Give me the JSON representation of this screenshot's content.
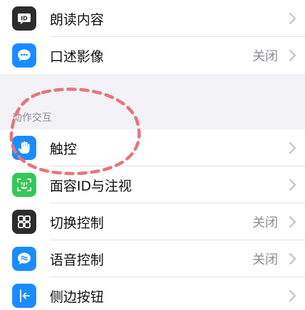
{
  "accessibility": {
    "top_rows": [
      {
        "label": "朗读内容",
        "value": "",
        "icon": "speech-bubble-icon",
        "color": "#2c2c2e"
      },
      {
        "label": "口述影像",
        "value": "关闭",
        "icon": "chat-bubble-icon",
        "color": "#1a8cff"
      }
    ],
    "section_header": "动作交互",
    "interaction_rows": [
      {
        "label": "触控",
        "value": "",
        "icon": "hand-touch-icon",
        "color": "#1a8cff"
      },
      {
        "label": "面容ID与注视",
        "value": "",
        "icon": "face-id-icon",
        "color": "#34c759"
      },
      {
        "label": "切换控制",
        "value": "关闭",
        "icon": "grid-icon",
        "color": "#2c2c2e"
      },
      {
        "label": "语音控制",
        "value": "关闭",
        "icon": "voice-bubble-icon",
        "color": "#1a8cff"
      },
      {
        "label": "侧边按钮",
        "value": "",
        "icon": "side-button-icon",
        "color": "#1a8cff"
      }
    ]
  },
  "annotation": {
    "color": "#e8747c"
  }
}
